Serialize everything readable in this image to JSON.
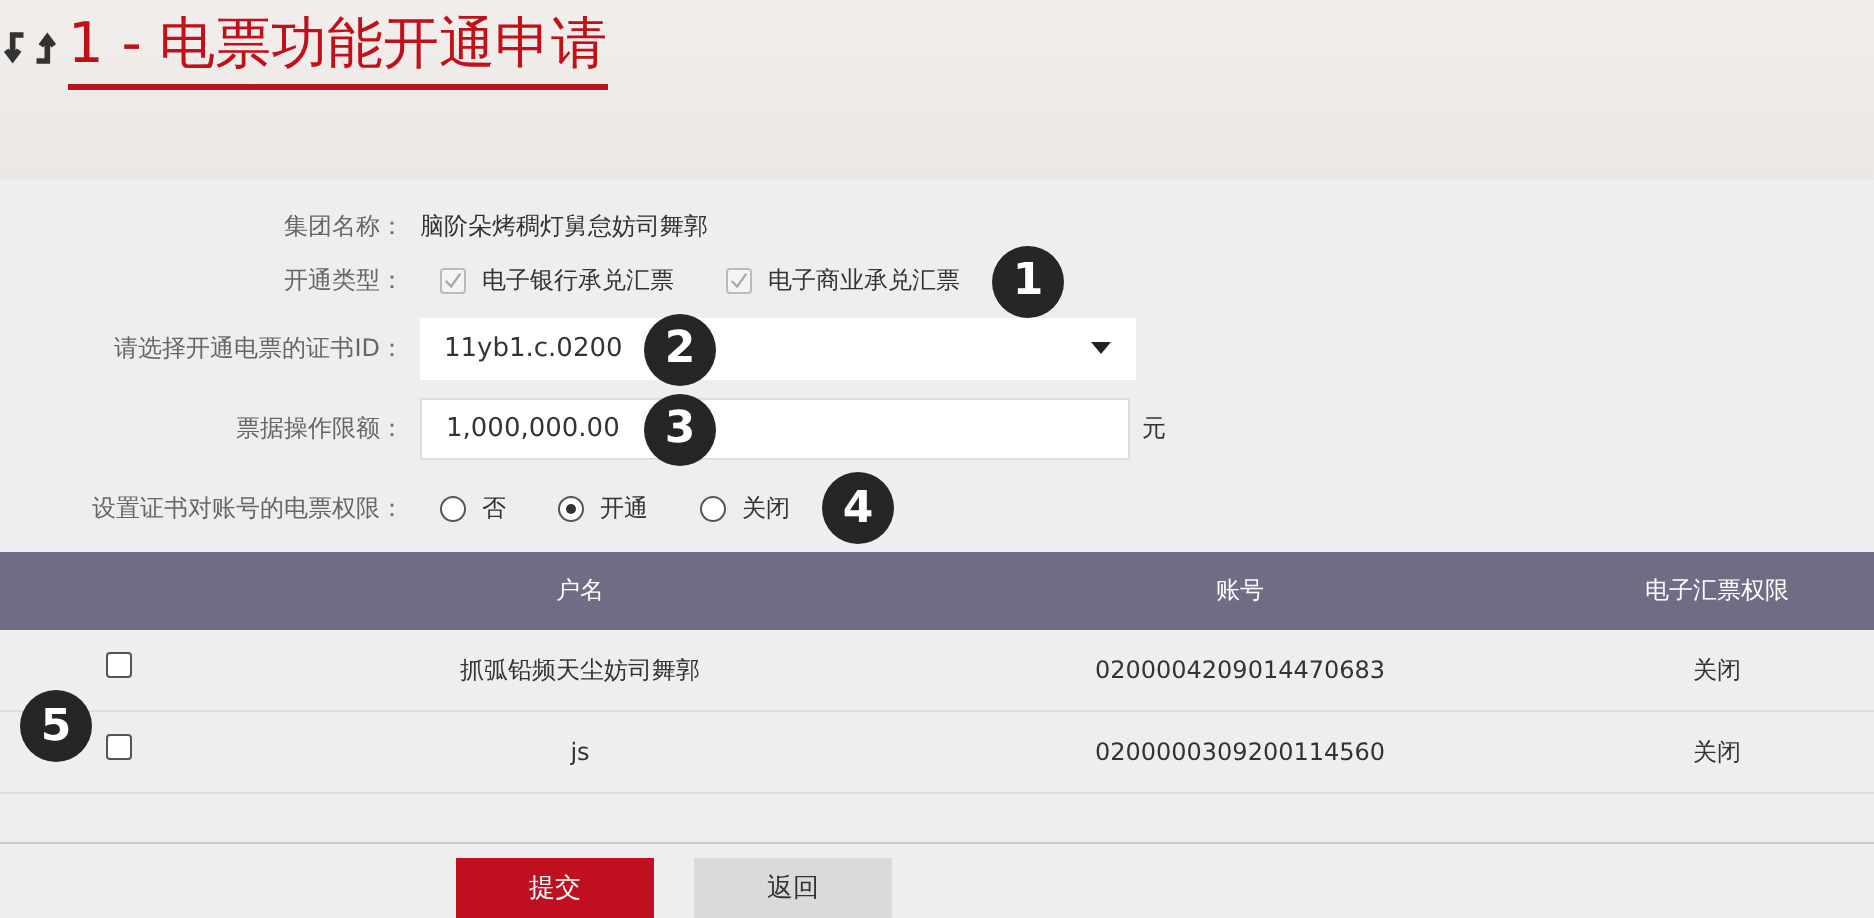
{
  "title": "1 - 电票功能开通申请",
  "form": {
    "group": {
      "label": "集团名称：",
      "value": "脑阶朵烤稠灯舅怠妨司舞郭"
    },
    "types": {
      "label": "开通类型：",
      "options": [
        {
          "label": "电子银行承兑汇票",
          "checked": true
        },
        {
          "label": "电子商业承兑汇票",
          "checked": true
        }
      ],
      "callout": "1"
    },
    "cert": {
      "label": "请选择开通电票的证书ID：",
      "value": "11yb1.c.0200",
      "callout": "2"
    },
    "limit": {
      "label": "票据操作限额：",
      "value": "1,000,000.00",
      "unit": "元",
      "callout": "3"
    },
    "permission": {
      "label": "设置证书对账号的电票权限：",
      "options": [
        {
          "label": "否",
          "selected": false
        },
        {
          "label": "开通",
          "selected": true
        },
        {
          "label": "关闭",
          "selected": false
        }
      ],
      "callout": "4"
    }
  },
  "table": {
    "columns": [
      "户名",
      "账号",
      "电子汇票权限"
    ],
    "callout": "5",
    "rows": [
      {
        "checked": false,
        "name": "抓弧铅频天尘妨司舞郭",
        "account": "0200004209014470683",
        "permission": "关闭"
      },
      {
        "checked": false,
        "name": "js",
        "account": "0200000309200114560",
        "permission": "关闭"
      }
    ]
  },
  "buttons": [
    {
      "label": "提交",
      "kind": "primary"
    },
    {
      "label": "返回",
      "kind": "secondary"
    }
  ]
}
